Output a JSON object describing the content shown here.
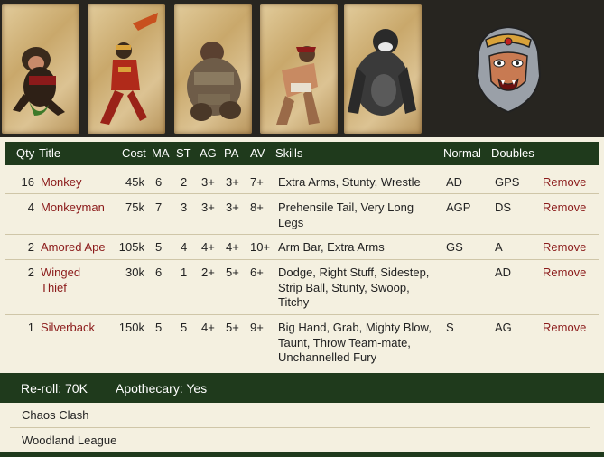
{
  "banner": {
    "cards": [
      {
        "name": "monkey-portrait"
      },
      {
        "name": "monkeyman-portrait"
      },
      {
        "name": "amored-ape-portrait"
      },
      {
        "name": "winged-thief-portrait"
      },
      {
        "name": "silverback-portrait"
      }
    ],
    "logo": "monkey-king-logo"
  },
  "table": {
    "headers": {
      "qty": "Qty",
      "title": "Title",
      "cost": "Cost",
      "ma": "MA",
      "st": "ST",
      "ag": "AG",
      "pa": "PA",
      "av": "AV",
      "skills": "Skills",
      "normal": "Normal",
      "doubles": "Doubles"
    },
    "rows": [
      {
        "qty": "16",
        "title": "Monkey",
        "cost": "45k",
        "ma": "6",
        "st": "2",
        "ag": "3+",
        "pa": "3+",
        "av": "7+",
        "skills": "Extra Arms, Stunty, Wrestle",
        "normal": "AD",
        "doubles": "GPS",
        "remove": "Remove"
      },
      {
        "qty": "4",
        "title": "Monkeyman",
        "cost": "75k",
        "ma": "7",
        "st": "3",
        "ag": "3+",
        "pa": "3+",
        "av": "8+",
        "skills": "Prehensile Tail, Very Long Legs",
        "normal": "AGP",
        "doubles": "DS",
        "remove": "Remove"
      },
      {
        "qty": "2",
        "title": "Amored Ape",
        "cost": "105k",
        "ma": "5",
        "st": "4",
        "ag": "4+",
        "pa": "4+",
        "av": "10+",
        "skills": "Arm Bar, Extra Arms",
        "normal": "GS",
        "doubles": "A",
        "remove": "Remove"
      },
      {
        "qty": "2",
        "title": "Winged Thief",
        "cost": "30k",
        "ma": "6",
        "st": "1",
        "ag": "2+",
        "pa": "5+",
        "av": "6+",
        "skills": "Dodge, Right Stuff, Sidestep, Strip Ball, Stunty, Swoop, Titchy",
        "normal": "",
        "doubles": "AD",
        "remove": "Remove"
      },
      {
        "qty": "1",
        "title": "Silverback",
        "cost": "150k",
        "ma": "5",
        "st": "5",
        "ag": "4+",
        "pa": "5+",
        "av": "9+",
        "skills": "Big Hand, Grab, Mighty Blow, Taunt, Throw Team-mate, Unchannelled Fury",
        "normal": "S",
        "doubles": "AG",
        "remove": "Remove"
      }
    ]
  },
  "footer": {
    "reroll": "Re-roll: 70K",
    "apothecary": "Apothecary: Yes"
  },
  "leagues": [
    "Chaos Clash",
    "Woodland League"
  ]
}
